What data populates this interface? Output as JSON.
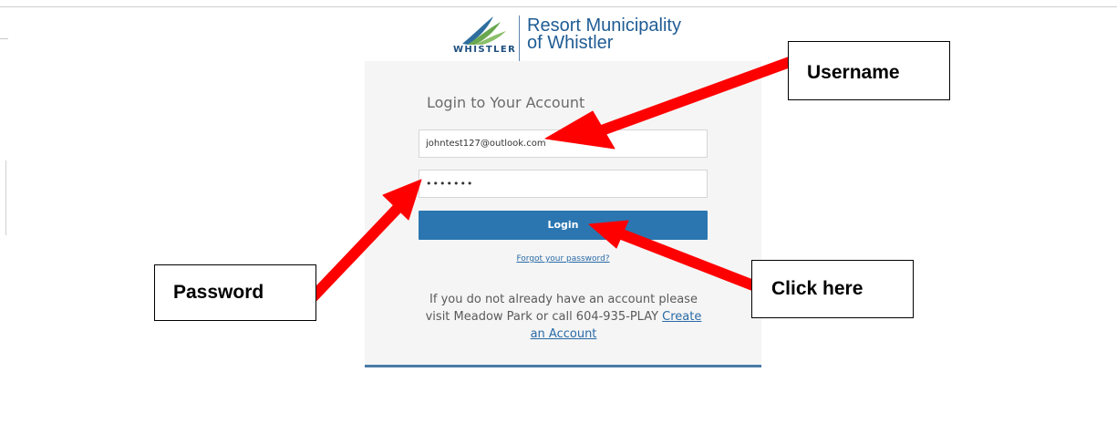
{
  "header": {
    "logo_wordmark": "WHISTLER",
    "org_name_line1": "Resort Municipality",
    "org_name_line2": "of Whistler"
  },
  "login": {
    "title": "Login to Your Account",
    "username_value": "johntest127@outlook.com",
    "password_value": "•••••••",
    "login_button": "Login",
    "forgot_link": "Forgot your password?",
    "signup_text": "If you do not already have an account please visit Meadow Park or call 604-935-PLAY",
    "create_account_link": "Create an Account"
  },
  "annotations": {
    "username_callout": "Username",
    "password_callout": "Password",
    "click_callout": "Click here",
    "arrow_color": "#ff0000"
  },
  "colors": {
    "button_blue": "#2b76b0",
    "panel_background": "#f5f5f5",
    "brand_blue": "#1f5c94"
  }
}
